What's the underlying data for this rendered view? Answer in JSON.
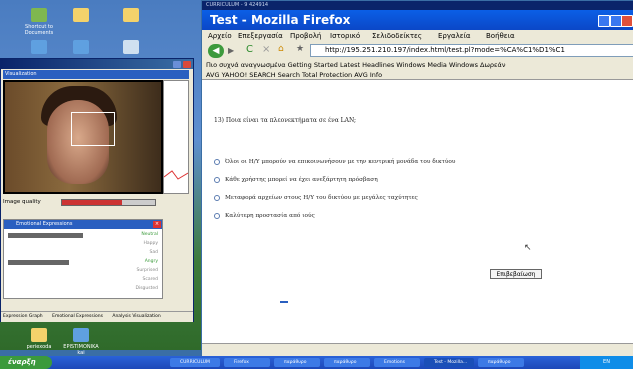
{
  "desktop": {
    "icons": [
      "Shortcut to Documents",
      "",
      "",
      "",
      "",
      ""
    ],
    "bottom_icons": [
      "periexoda",
      "EPISTIMONIKA kai semiplash..."
    ]
  },
  "left_app": {
    "video_title": "Visualization",
    "image_quality_label": "Image quality",
    "image_quality": 0.65,
    "emotions_title": "Emotional Expressions",
    "emotions": [
      {
        "label": "Neutral",
        "value": 0.68
      },
      {
        "label": "Happy",
        "value": 0.0
      },
      {
        "label": "Sad",
        "value": 0.0
      },
      {
        "label": "Angry",
        "value": 0.55
      },
      {
        "label": "Surprised",
        "value": 0.0
      },
      {
        "label": "Scared",
        "value": 0.0
      },
      {
        "label": "Disgusted",
        "value": 0.0
      }
    ],
    "tabs": [
      "Expression Graph",
      "Emotional Expressions",
      "Analysis Visualization"
    ]
  },
  "firefox": {
    "top_strip": "CURRICULUM - 9 424914",
    "title": "Test - Mozilla Firefox",
    "menu": [
      "Αρχείο",
      "Επεξεργασία",
      "Προβολή",
      "Ιστορικό",
      "Σελιδοδείκτες",
      "Εργαλεία",
      "Βοήθεια"
    ],
    "url": "http://195.251.210.197/index.html/test.pl?mode=%CA%C1%D1%C1",
    "bookmarks": "Πιο συχνά αναγνωσμένα   Getting Started   Latest Headlines   Windows Media   Windows   Δωρεάν",
    "avg_bar": "AVG   YAHOO! SEARCH   Search   Total Protection   AVG Info",
    "question": "13) Ποια είναι τα πλεονεκτήματα σε ένα LAN;",
    "options": [
      "Όλοι οι Η/Υ μπορούν να επικοινωνήσουν με την κεντρική μονάδα του δικτύου",
      "Κάθε χρήστης μπορεί να έχει ανεξάρτητη πρόσβαση",
      "Μεταφορά αρχείων στους Η/Υ του δικτύου με μεγάλες ταχύτητες",
      "Καλύτερη προστασία από ιούς"
    ],
    "submit_label": "Επιβεβαίωση"
  },
  "taskbar": {
    "start_label": "έναρξη",
    "buttons": [
      "CURRICULUM",
      "Firefox",
      "παράθυρο",
      "παράθυρο",
      "Emotions",
      "Test - Mozilla...",
      "παράθυρο"
    ],
    "clock": "EN"
  },
  "colors": {
    "firefox_title": "#0b47c7",
    "start_button": "#3b9a3b",
    "quality_fill": "#c33333"
  }
}
